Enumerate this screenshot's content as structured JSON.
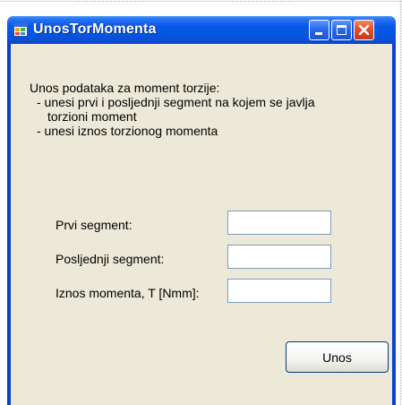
{
  "window": {
    "title": "UnosTorMomenta",
    "icon": "app-window-icon",
    "controls": [
      "minimize-icon",
      "maximize-icon",
      "close-icon"
    ]
  },
  "intro": {
    "line1": "Unos podataka za moment torzije:",
    "line2": "- unesi prvi i posljednji segment na kojem se javlja",
    "line3": "torzioni moment",
    "line4": "- unesi iznos torzionog momenta"
  },
  "form": {
    "first_segment_label": "Prvi segment:",
    "first_segment_value": "",
    "last_segment_label": "Posljednji segment:",
    "last_segment_value": "",
    "moment_label": "Iznos momenta, T [Nmm]:",
    "moment_value": ""
  },
  "actions": {
    "submit_label": "Unos"
  },
  "colors": {
    "titlebar": "#0a58e8",
    "client_background": "#ece9d8",
    "close_button": "#e0502a"
  }
}
